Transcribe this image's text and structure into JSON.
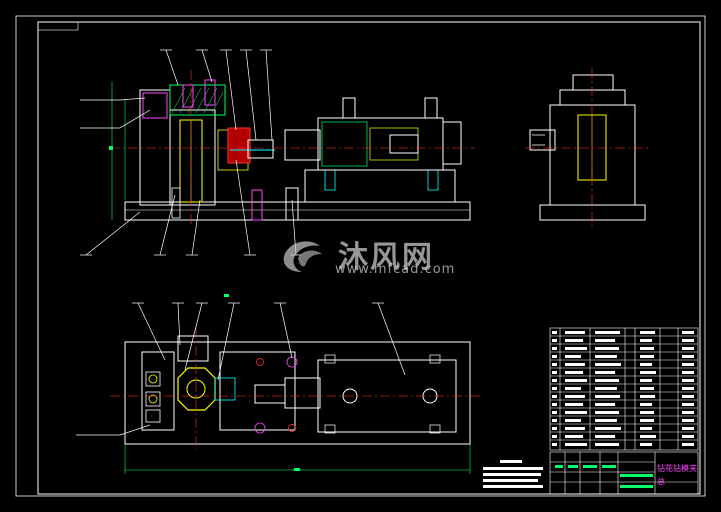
{
  "watermark": {
    "brand": "沐风网",
    "url": "www.mfcad.com"
  },
  "title_block": {
    "drawing_title": "钻花钻模夹",
    "sheet_label": "总"
  },
  "colors": {
    "background": "#000000",
    "frame": "#ffffff",
    "centerline": "#ff3030",
    "dimension": "#00ff66",
    "part_outline": "#ffffff",
    "accent_yellow": "#ffff00",
    "accent_cyan": "#00ffff",
    "accent_magenta": "#ff44ff"
  },
  "icons": {
    "watermark_logo": "mfcad-logo-icon"
  }
}
